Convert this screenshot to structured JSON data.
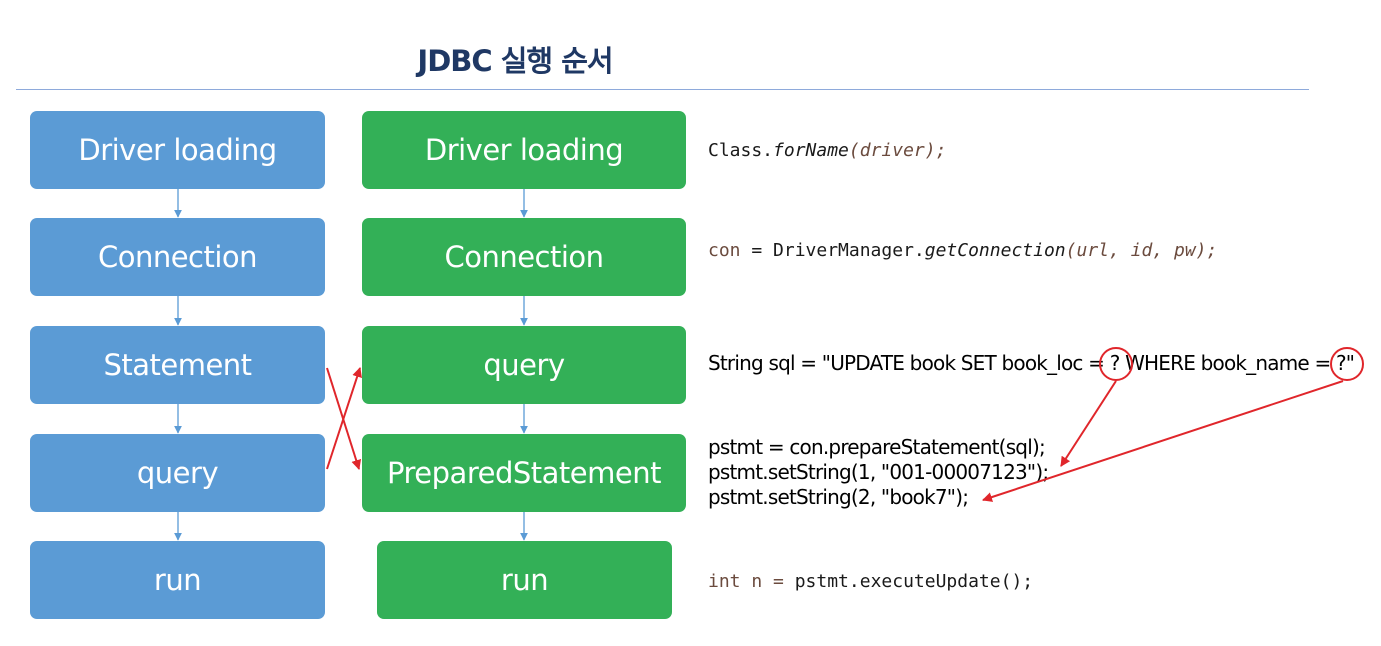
{
  "title": "JDBC 실행 순서",
  "left_flow": [
    "Driver loading",
    "Connection",
    "Statement",
    "query",
    "run"
  ],
  "right_flow": [
    "Driver loading",
    "Connection",
    "query",
    "PreparedStatement",
    "run"
  ],
  "code": {
    "class_prefix": "Class.",
    "for_name": "forName",
    "for_name_args": "(driver);",
    "con_prefix": "con",
    "con_eq": " = DriverManager.",
    "get_connection": "getConnection",
    "get_connection_args": "(url, id, pw);",
    "sql_line": "String sql = \"UPDATE book SET book_loc = ? WHERE book_name = ?\"",
    "prepare_line": "pstmt = con.prepareStatement(sql);",
    "set_string_1": "pstmt.setString(1, \"001-00007123\");",
    "set_string_2": "pstmt.setString(2, \"book7\");",
    "int_n": "int n = ",
    "pstmt_var": "pstmt",
    "execute_update": ".executeUpdate();"
  },
  "colors": {
    "blue_box": "#5b9bd5",
    "green_box": "#33b057",
    "annotation_red": "#e0262b",
    "title": "#1f3864"
  }
}
